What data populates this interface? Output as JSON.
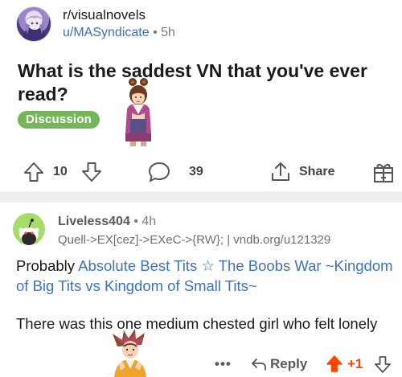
{
  "post": {
    "subreddit": "r/visualnovels",
    "author": "u/MASyndicate",
    "separator": "•",
    "age": "5h",
    "title": "What is the saddest VN that you've ever read?",
    "flair": "Discussion",
    "flair_color": "#75b65b",
    "score": "10",
    "comment_count": "39",
    "share_label": "Share"
  },
  "comment": {
    "author": "Liveless404",
    "separator": "•",
    "age": "4h",
    "user_flair": "Quell->EX[cez]->EXeC->{RW}; | vndb.org/u121329",
    "body_prefix": "Probably ",
    "body_link": "Absolute Best Tits ☆ The Boobs War ~Kingdom of Big Tits vs Kingdom of Small Tits~",
    "body_second": "There was this one medium chested girl who felt lonely",
    "more": "•••",
    "reply_label": "Reply",
    "score": "+1",
    "score_color": "#ff4500",
    "link_color": "#3a73c4"
  },
  "icons": {
    "upvote": "arrow-up-outline-icon",
    "downvote": "arrow-down-outline-icon",
    "comment": "speech-bubble-icon",
    "share": "share-arrow-icon",
    "award": "gift-box-icon",
    "reply": "reply-arrow-icon",
    "upvoted": "arrow-up-filled-icon"
  }
}
